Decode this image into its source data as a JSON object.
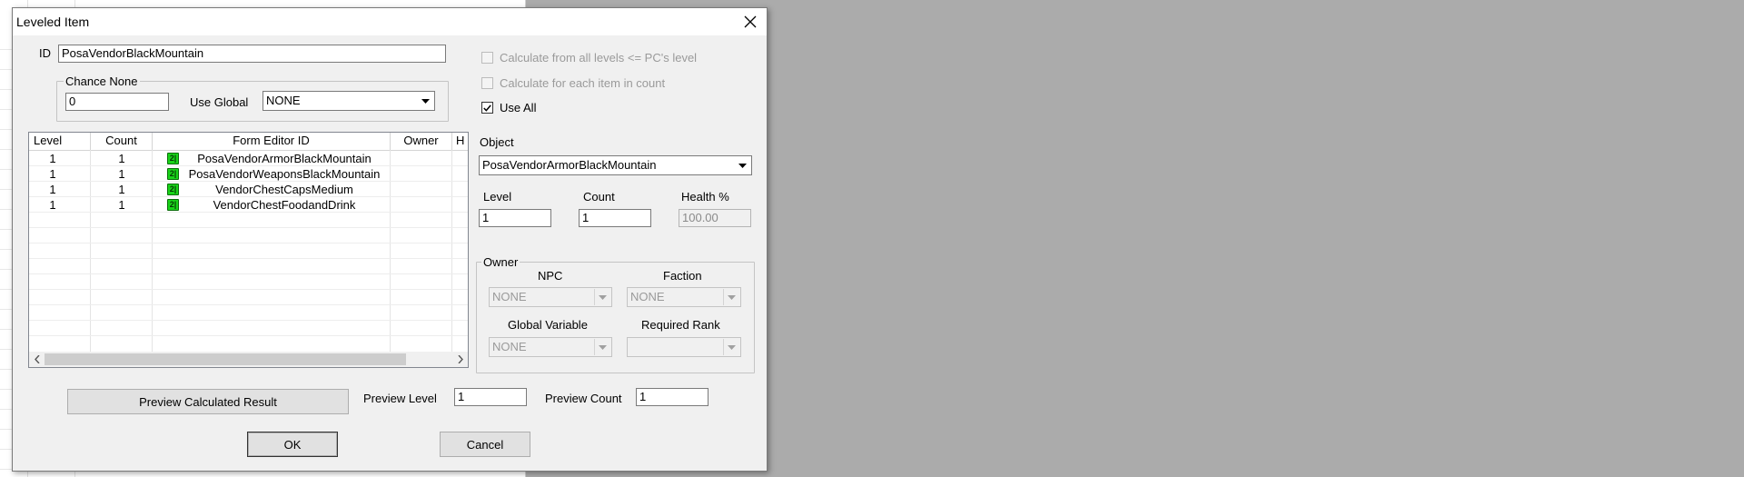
{
  "dialog": {
    "title": "Leveled Item",
    "id_label": "ID",
    "id_value": "PosaVendorBlackMountain",
    "chance_none": {
      "legend": "Chance None",
      "value": "0",
      "use_global_label": "Use Global",
      "use_global_value": "NONE"
    },
    "list": {
      "columns": [
        "Level",
        "Count",
        "Form Editor ID",
        "Owner",
        "H"
      ],
      "rows": [
        {
          "level": "1",
          "count": "1",
          "form_id": "PosaVendorArmorBlackMountain",
          "icon": "2|"
        },
        {
          "level": "1",
          "count": "1",
          "form_id": "PosaVendorWeaponsBlackMountain",
          "icon": "2|"
        },
        {
          "level": "1",
          "count": "1",
          "form_id": "VendorChestCapsMedium",
          "icon": "2|"
        },
        {
          "level": "1",
          "count": "1",
          "form_id": "VendorChestFoodandDrink",
          "icon": "2|"
        }
      ]
    },
    "options": {
      "calc_all_levels": {
        "label": "Calculate from all levels <= PC's level",
        "checked": false,
        "enabled": false
      },
      "calc_each_item": {
        "label": "Calculate for each item in count",
        "checked": false,
        "enabled": false
      },
      "use_all": {
        "label": "Use All",
        "checked": true,
        "enabled": true
      }
    },
    "object": {
      "label": "Object",
      "value": "PosaVendorArmorBlackMountain"
    },
    "level": {
      "label": "Level",
      "value": "1"
    },
    "count": {
      "label": "Count",
      "value": "1"
    },
    "health": {
      "label": "Health %",
      "value": "100.00"
    },
    "owner": {
      "legend": "Owner",
      "npc_label": "NPC",
      "npc_value": "NONE",
      "faction_label": "Faction",
      "faction_value": "NONE",
      "global_label": "Global Variable",
      "global_value": "NONE",
      "rank_label": "Required Rank",
      "rank_value": ""
    },
    "preview": {
      "button_label": "Preview Calculated Result",
      "level_label": "Preview Level",
      "level_value": "1",
      "count_label": "Preview Count",
      "count_value": "1"
    },
    "ok_label": "OK",
    "cancel_label": "Cancel"
  },
  "icons": {
    "close": "close-icon",
    "dropdown": "chevron-down-icon",
    "check": "checkmark-icon",
    "scroll_left": "chevron-left-icon",
    "scroll_right": "chevron-right-icon",
    "item": "leveled-item-icon"
  },
  "colors": {
    "desktop": "#ababab",
    "dialog_bg": "#f0f0f0",
    "item_icon": "#19d419"
  }
}
